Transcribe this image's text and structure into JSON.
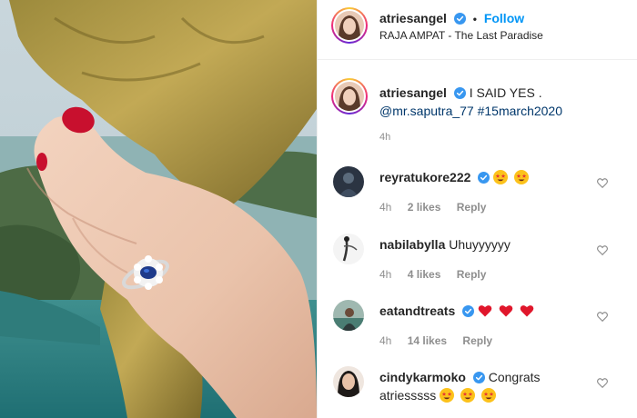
{
  "header": {
    "username": "atriesangel",
    "follow_label": "Follow",
    "separator": "•",
    "location": "RAJA AMPAT - The Last Paradise"
  },
  "caption": {
    "username": "atriesangel",
    "text": "I SAID YES .",
    "mention": "@mr.saputra_77",
    "hashtag": "#15march2020",
    "time": "4h"
  },
  "comments": [
    {
      "username": "reyratukore222",
      "verified": true,
      "text": "",
      "emojis": [
        "star-struck-emoji",
        "star-struck-emoji"
      ],
      "time": "4h",
      "likes": "2 likes",
      "reply": "Reply"
    },
    {
      "username": "nabilabylla",
      "verified": false,
      "text": "Uhuyyyyyy",
      "emojis": [],
      "time": "4h",
      "likes": "4 likes",
      "reply": "Reply"
    },
    {
      "username": "eatandtreats",
      "verified": true,
      "text": "",
      "emojis": [
        "red-heart-emoji",
        "red-heart-emoji",
        "red-heart-emoji"
      ],
      "time": "4h",
      "likes": "14 likes",
      "reply": "Reply"
    },
    {
      "username": "cindykarmoko",
      "verified": true,
      "text": "Congrats atriesssss",
      "emojis": [
        "star-struck-emoji",
        "star-struck-emoji",
        "star-struck-emoji"
      ],
      "time": "",
      "likes": "",
      "reply": ""
    }
  ],
  "colors": {
    "follow": "#0095f6",
    "verified": "#3897f0",
    "link": "#00376b",
    "meta": "#8e8e8e",
    "border": "#efefef"
  },
  "icons": {
    "verified": "verified-badge-icon",
    "like": "heart-outline-icon"
  }
}
